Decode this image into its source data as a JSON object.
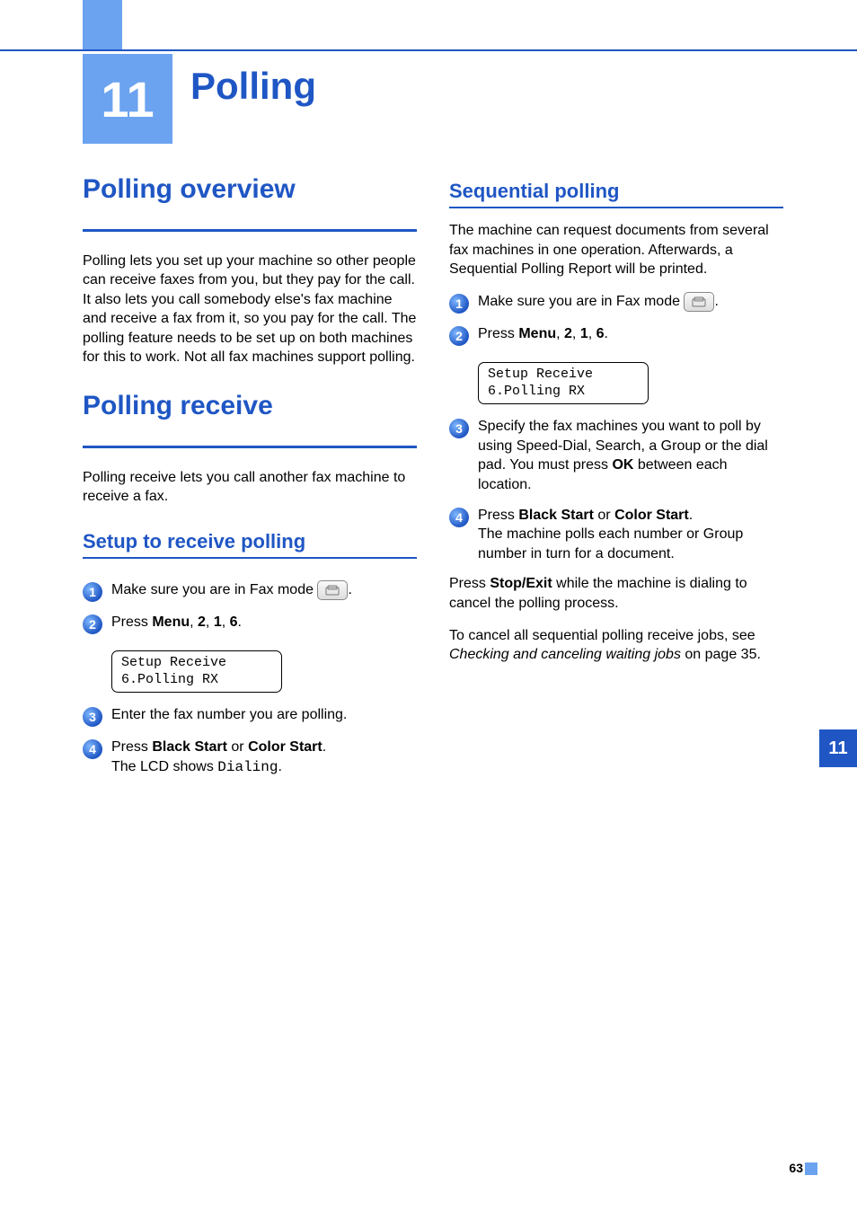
{
  "chapter": {
    "number": "11",
    "title": "Polling"
  },
  "side_tab": "11",
  "page_number": "63",
  "left": {
    "h1a": "Polling overview",
    "p1": "Polling lets you set up your machine so other people can receive faxes from you, but they pay for the call. It also lets you call somebody else's fax machine and receive a fax from it, so you pay for the call. The polling feature needs to be set up on both machines for this to work. Not all fax machines support polling.",
    "h1b": "Polling receive",
    "p2": "Polling receive lets you call another fax machine to receive a fax.",
    "h2": "Setup to receive polling",
    "steps": {
      "s1": {
        "n": "1",
        "pre": "Make sure you are in Fax mode ",
        "icon": "fax-icon",
        "post": "."
      },
      "s2": {
        "n": "2",
        "pre": "Press ",
        "b1": "Menu",
        "mid1": ", ",
        "b2": "2",
        "mid2": ", ",
        "b3": "1",
        "mid3": ", ",
        "b4": "6",
        "post": "."
      },
      "lcd": {
        "l1": "Setup Receive",
        "l2": "6.Polling RX"
      },
      "s3": {
        "n": "3",
        "text": "Enter the fax number you are polling."
      },
      "s4": {
        "n": "4",
        "pre": "Press ",
        "b1": "Black Start",
        "mid": " or ",
        "b2": "Color Start",
        "post1": ".",
        "line2a": "The LCD shows ",
        "line2mono": "Dialing",
        "line2b": "."
      }
    }
  },
  "right": {
    "h2": "Sequential polling",
    "p1": "The machine can request documents from several fax machines in one operation. Afterwards, a Sequential Polling Report will be printed.",
    "steps": {
      "s1": {
        "n": "1",
        "pre": "Make sure you are in Fax mode ",
        "icon": "fax-icon",
        "post": "."
      },
      "s2": {
        "n": "2",
        "pre": "Press ",
        "b1": "Menu",
        "mid1": ", ",
        "b2": "2",
        "mid2": ", ",
        "b3": "1",
        "mid3": ", ",
        "b4": "6",
        "post": "."
      },
      "lcd": {
        "l1": "Setup Receive",
        "l2": "6.Polling RX"
      },
      "s3": {
        "n": "3",
        "pre": "Specify the fax machines you want to poll by using Speed-Dial, Search, a Group or the dial pad. You must press ",
        "b": "OK",
        "post": " between each location."
      },
      "s4": {
        "n": "4",
        "pre": "Press ",
        "b1": "Black Start",
        "mid": " or ",
        "b2": "Color Start",
        "post1": ".",
        "line2": "The machine polls each number or Group number in turn for a document."
      }
    },
    "p2a": "Press ",
    "p2b": "Stop/Exit",
    "p2c": " while the machine is dialing to cancel the polling process.",
    "p3a": "To cancel all sequential polling receive jobs, see ",
    "p3i": "Checking and canceling waiting jobs",
    "p3b": " on page 35."
  }
}
